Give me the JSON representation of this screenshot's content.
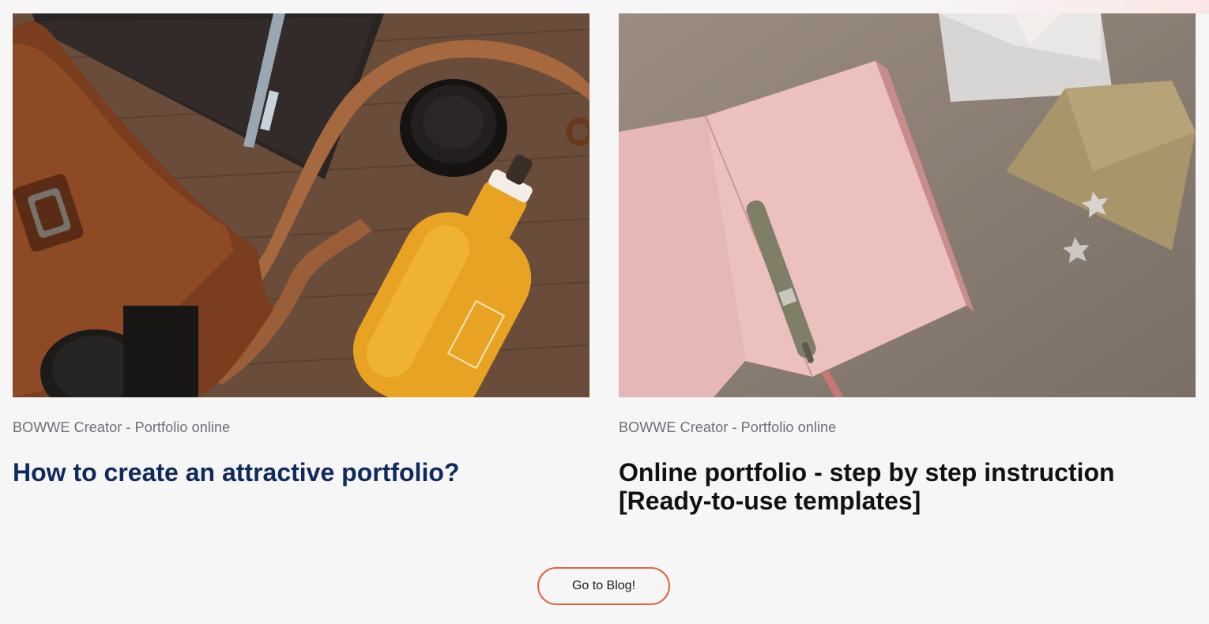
{
  "posts": [
    {
      "meta": "BOWWE Creator - Portfolio online",
      "title": "How to create an attractive portfolio?",
      "image_subject": "leather bag, camera, lens cap and orange juice bottle on a wooden table"
    },
    {
      "meta": "BOWWE Creator - Portfolio online",
      "title": "Online portfolio - step by step instruction [Ready-to-use templates]",
      "image_subject": "open pink notebook with pen, envelopes and star pins on a taupe surface"
    }
  ],
  "blog_button": {
    "label": "Go to Blog!"
  },
  "colors": {
    "background": "#f6f6f7",
    "accent": "#e0643f",
    "title_blue": "#0f2a5b",
    "meta_gray": "#6b6f75"
  }
}
